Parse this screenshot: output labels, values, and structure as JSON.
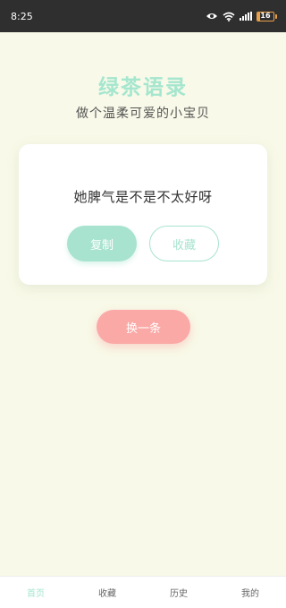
{
  "status_bar": {
    "time": "8:25",
    "battery_level": "16",
    "icons": [
      "eye-icon",
      "wifi-icon",
      "signal-icon",
      "battery-icon"
    ]
  },
  "header": {
    "title": "绿茶语录",
    "subtitle": "做个温柔可爱的小宝贝"
  },
  "quote_card": {
    "text": "她脾气是不是不太好呀",
    "copy_label": "复制",
    "favorite_label": "收藏"
  },
  "next_button_label": "换一条",
  "tab_bar": {
    "items": [
      {
        "label": "首页",
        "active": true
      },
      {
        "label": "收藏",
        "active": false
      },
      {
        "label": "历史",
        "active": false
      },
      {
        "label": "我的",
        "active": false
      }
    ]
  },
  "colors": {
    "accent_green": "#a5e6cf",
    "accent_pink": "#fba9a6",
    "background": "#f8f9e8",
    "status_bar": "#2f2f2f"
  }
}
